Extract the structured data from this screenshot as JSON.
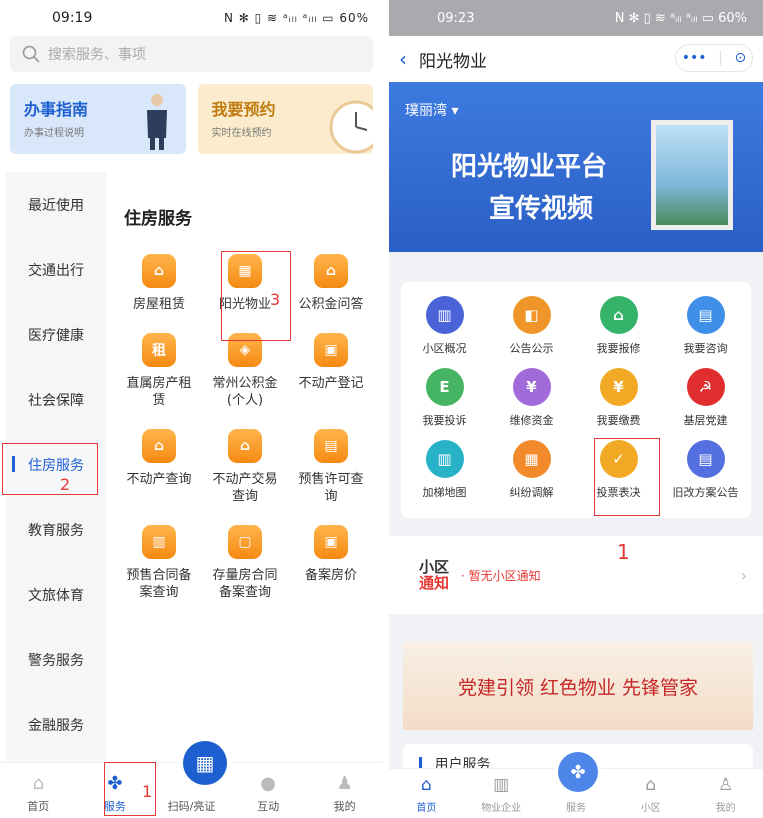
{
  "left": {
    "status": {
      "time": "09:19",
      "icons": "N ✻ ▯ ≋ ᵃᵢₗₗ ᵃᵢₗₗ ▭ 60%"
    },
    "search": {
      "placeholder": "搜索服务、事项"
    },
    "cards": [
      {
        "title": "办事指南",
        "subtitle": "办事过程说明"
      },
      {
        "title": "我要预约",
        "subtitle": "实时在线预约"
      }
    ],
    "tabs": [
      "最近使用",
      "交通出行",
      "医疗健康",
      "社会保障",
      "住房服务",
      "教育服务",
      "文旅体育",
      "警务服务",
      "金融服务"
    ],
    "section_title": "住房服务",
    "services": [
      "房屋租赁",
      "阳光物业",
      "公积金问答",
      "直属房产租赁",
      "常州公积金(个人)",
      "不动产登记",
      "不动产查询",
      "不动产交易查询",
      "预售许可查询",
      "预售合同备案查询",
      "存量房合同备案查询",
      "备案房价"
    ],
    "service_glyphs": [
      "⌂",
      "▦",
      "⌂",
      "租",
      "◈",
      "▣",
      "⌂",
      "⌂",
      "▤",
      "▥",
      "▢",
      "▣"
    ],
    "tabbar": [
      "首页",
      "服务",
      "扫码/亮证",
      "互动",
      "我的"
    ],
    "markers": {
      "m1": "1",
      "m2": "2",
      "m3": "3"
    }
  },
  "right": {
    "status": {
      "time": "09:23",
      "icons": "N ✻ ▯ ≋ ᵃᵢₗₗ ᵃᵢₗₗ ▭ 60%"
    },
    "nav_title": "阳光物业",
    "capsule": {
      "more": "•••",
      "close": "⊙"
    },
    "banner": {
      "location": "璞丽湾 ▾",
      "line1": "阳光物业平台",
      "line2": "宣传视频"
    },
    "services": [
      {
        "label": "小区概况",
        "color": "#4b63d8",
        "glyph": "▥"
      },
      {
        "label": "公告公示",
        "color": "#f0952a",
        "glyph": "◧"
      },
      {
        "label": "我要报修",
        "color": "#35b36b",
        "glyph": "⌂"
      },
      {
        "label": "我要咨询",
        "color": "#3f8fe8",
        "glyph": "▤"
      },
      {
        "label": "我要投诉",
        "color": "#45b563",
        "glyph": "E"
      },
      {
        "label": "维修资金",
        "color": "#a06ad8",
        "glyph": "¥"
      },
      {
        "label": "我要缴费",
        "color": "#f2a925",
        "glyph": "¥"
      },
      {
        "label": "基层党建",
        "color": "#e02e2e",
        "glyph": "☭"
      },
      {
        "label": "加梯地图",
        "color": "#28b2c8",
        "glyph": "▥"
      },
      {
        "label": "纠纷调解",
        "color": "#f28a2c",
        "glyph": "▦"
      },
      {
        "label": "投票表决",
        "color": "#f2a925",
        "glyph": "✓"
      },
      {
        "label": "旧改方案公告",
        "color": "#5470e0",
        "glyph": "▤"
      }
    ],
    "notice": {
      "label1": "小区",
      "label2": "通知",
      "text": "· 暂无小区通知",
      "arrow": "›"
    },
    "party_banner": "党建引领 红色物业 先锋管家",
    "user_service": "用户服务",
    "tabbar": [
      "首页",
      "物业企业",
      "服务",
      "小区",
      "我的"
    ],
    "marker1": "1"
  }
}
